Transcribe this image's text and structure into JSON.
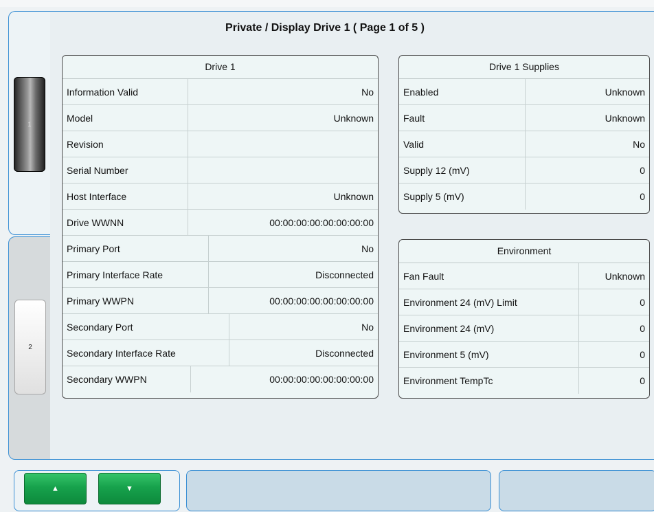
{
  "page": {
    "title": "Private / Display Drive 1 ( Page 1 of 5 )"
  },
  "side_tabs": [
    {
      "label": "1"
    },
    {
      "label": "2"
    }
  ],
  "drive": {
    "header": "Drive 1",
    "rows": [
      {
        "label": "Information Valid",
        "value": "No"
      },
      {
        "label": "Model",
        "value": "Unknown"
      },
      {
        "label": "Revision",
        "value": ""
      },
      {
        "label": "Serial Number",
        "value": ""
      },
      {
        "label": "Host Interface",
        "value": "Unknown"
      },
      {
        "label": "Drive WWNN",
        "value": "00:00:00:00:00:00:00:00"
      },
      {
        "label": "Primary Port",
        "value": "No"
      },
      {
        "label": "Primary Interface Rate",
        "value": "Disconnected"
      },
      {
        "label": "Primary WWPN",
        "value": "00:00:00:00:00:00:00:00"
      },
      {
        "label": "Secondary Port",
        "value": "No"
      },
      {
        "label": "Secondary Interface Rate",
        "value": "Disconnected"
      },
      {
        "label": "Secondary WWPN",
        "value": "00:00:00:00:00:00:00:00"
      }
    ]
  },
  "supplies": {
    "header": "Drive 1 Supplies",
    "rows": [
      {
        "label": "Enabled",
        "value": "Unknown"
      },
      {
        "label": "Fault",
        "value": "Unknown"
      },
      {
        "label": "Valid",
        "value": "No"
      },
      {
        "label": "Supply 12 (mV)",
        "value": "0"
      },
      {
        "label": "Supply 5 (mV)",
        "value": "0"
      }
    ]
  },
  "environment": {
    "header": "Environment",
    "rows": [
      {
        "label": "Fan Fault",
        "value": "Unknown"
      },
      {
        "label": "Environment 24 (mV) Limit",
        "value": "0"
      },
      {
        "label": "Environment 24 (mV)",
        "value": "0"
      },
      {
        "label": "Environment 5 (mV)",
        "value": "0"
      },
      {
        "label": "Environment TempTc",
        "value": "0"
      }
    ]
  },
  "nav": {
    "up_glyph": "▲",
    "down_glyph": "▼"
  },
  "colors": {
    "accent_border": "#3a8fd4",
    "button_green": "#17a24c",
    "table_bg": "#eef6f6"
  }
}
